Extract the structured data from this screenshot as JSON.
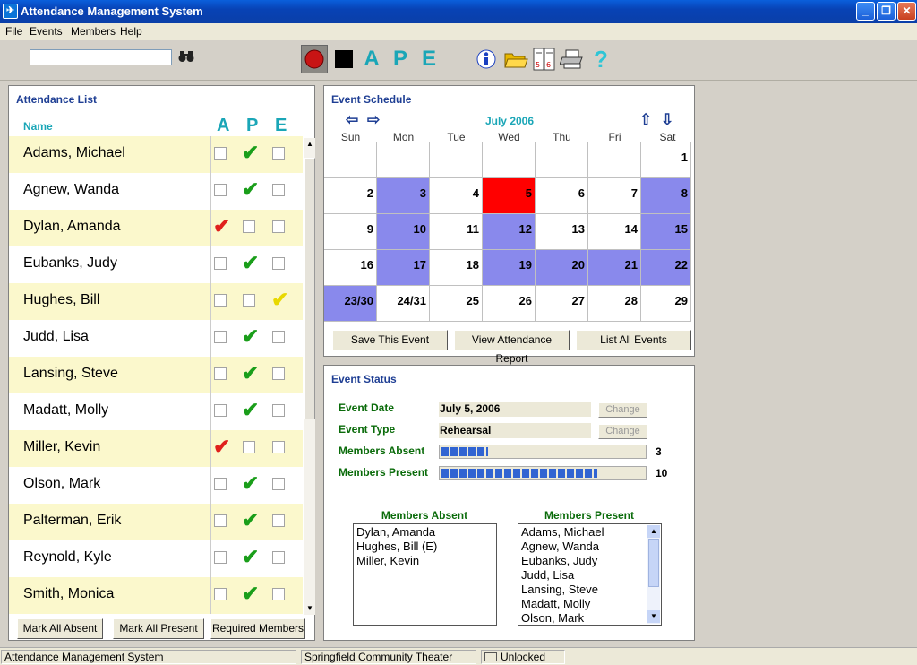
{
  "window": {
    "title": "Attendance Management System"
  },
  "menu": [
    "File",
    "Events",
    "Members",
    "Help"
  ],
  "toolbar": {
    "search_value": "",
    "ape": [
      "A",
      "P",
      "E"
    ]
  },
  "attendance": {
    "title": "Attendance List",
    "col_name": "Name",
    "cols": [
      "A",
      "P",
      "E"
    ],
    "rows": [
      {
        "name": "Adams, Michael",
        "status": "P"
      },
      {
        "name": "Agnew, Wanda",
        "status": "P"
      },
      {
        "name": "Dylan, Amanda",
        "status": "A"
      },
      {
        "name": "Eubanks, Judy",
        "status": "P"
      },
      {
        "name": "Hughes, Bill",
        "status": "E"
      },
      {
        "name": "Judd, Lisa",
        "status": "P"
      },
      {
        "name": "Lansing, Steve",
        "status": "P"
      },
      {
        "name": "Madatt, Molly",
        "status": "P"
      },
      {
        "name": "Miller, Kevin",
        "status": "A"
      },
      {
        "name": "Olson, Mark",
        "status": "P"
      },
      {
        "name": "Palterman, Erik",
        "status": "P"
      },
      {
        "name": "Reynold, Kyle",
        "status": "P"
      },
      {
        "name": "Smith, Monica",
        "status": "P"
      }
    ],
    "buttons": [
      "Mark All Absent",
      "Mark All Present",
      "Required Members"
    ]
  },
  "schedule": {
    "title": "Event Schedule",
    "month": "July 2006",
    "dow": [
      "Sun",
      "Mon",
      "Tue",
      "Wed",
      "Thu",
      "Fri",
      "Sat"
    ],
    "weeks": [
      [
        "",
        "",
        "",
        "",
        "",
        "",
        "1"
      ],
      [
        "2",
        "3",
        "4",
        "5",
        "6",
        "7",
        "8"
      ],
      [
        "9",
        "10",
        "11",
        "12",
        "13",
        "14",
        "15"
      ],
      [
        "16",
        "17",
        "18",
        "19",
        "20",
        "21",
        "22"
      ],
      [
        "23/30",
        "24/31",
        "25",
        "26",
        "27",
        "28",
        "29"
      ]
    ],
    "event_days": [
      "3",
      "8",
      "10",
      "12",
      "15",
      "17",
      "19",
      "20",
      "21",
      "22",
      "23/30"
    ],
    "selected_day": "5",
    "buttons": [
      "Save This Event",
      "View Attendance Report",
      "List All Events"
    ]
  },
  "status": {
    "title": "Event Status",
    "event_date_label": "Event Date",
    "event_date": "July 5, 2006",
    "event_type_label": "Event Type",
    "event_type": "Rehearsal",
    "change_label": "Change",
    "absent_label": "Members Absent",
    "absent_count": "3",
    "present_label": "Members Present",
    "present_count": "10",
    "absent_fraction": 0.23,
    "present_fraction": 0.77,
    "absent_list_title": "Members Absent",
    "present_list_title": "Members Present",
    "absent_list": [
      "Dylan, Amanda",
      "Hughes, Bill (E)",
      "Miller, Kevin"
    ],
    "present_list": [
      "Adams, Michael",
      "Agnew, Wanda",
      "Eubanks, Judy",
      "Judd, Lisa",
      "Lansing, Steve",
      "Madatt, Molly",
      "Olson, Mark"
    ]
  },
  "statusbar": [
    "Attendance Management System",
    "Springfield Community Theater",
    "Unlocked"
  ],
  "colors": {
    "event": "#8989ec",
    "selected": "#ff0000",
    "absent_check": "#e0201c",
    "present_check": "#1a9e1a",
    "excused_check": "#e8d800",
    "accent": "#1aa6b7"
  }
}
